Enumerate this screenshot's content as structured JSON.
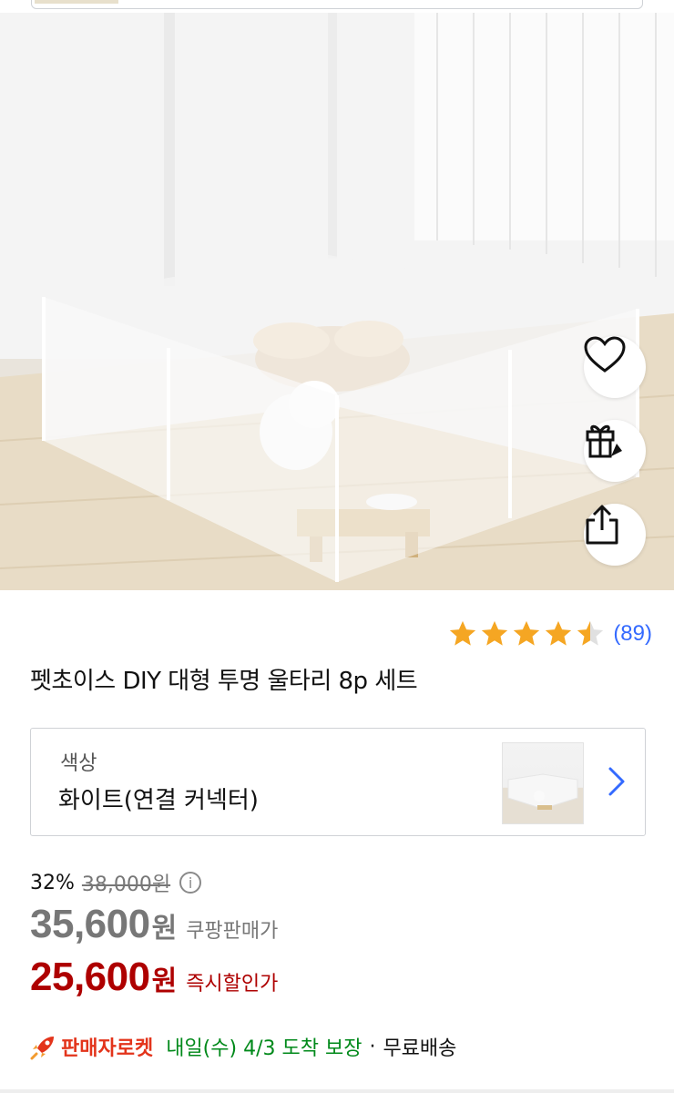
{
  "product": {
    "title": "펫초이스 DIY 대형 투명 울타리 8p 세트",
    "image_alt": "투명 울타리 세트 이미지"
  },
  "actions": {
    "wishlist_icon": "heart-icon",
    "gift_icon": "gift-icon",
    "share_icon": "share-icon"
  },
  "rating": {
    "stars": 4.5,
    "count": "(89)"
  },
  "option": {
    "label": "색상",
    "value": "화이트(연결 커넥터)"
  },
  "pricing": {
    "discount_rate": "32%",
    "original_price": "38,000원",
    "sale_price": "35,600",
    "sale_unit": "원",
    "sale_label": "쿠팡판매가",
    "instant_price": "25,600",
    "instant_unit": "원",
    "instant_label": "즉시할인가",
    "info_icon": "i"
  },
  "delivery": {
    "badge": "판매자로켓",
    "eta": "내일(수) 4/3 도착 보장",
    "separator": "·",
    "shipping": "무료배송"
  },
  "colors": {
    "link_blue": "#346aff",
    "price_red": "#ae0000",
    "eta_green": "#00891a",
    "rocket_red": "#e3341b",
    "star_gold": "#f5a623"
  }
}
